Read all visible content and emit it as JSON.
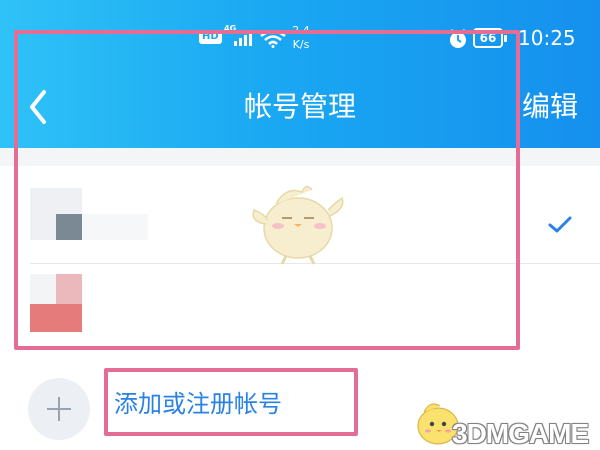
{
  "status_bar": {
    "hd": "HD",
    "network": "4G",
    "speed_value": "2.4",
    "speed_unit": "K/s",
    "battery": "66",
    "time": "10:25"
  },
  "header": {
    "title": "帐号管理",
    "edit_label": "编辑",
    "back_icon": "chevron-left-icon"
  },
  "accounts": [
    {
      "selected": true
    },
    {
      "selected": false
    }
  ],
  "add_account": {
    "label": "添加或注册帐号",
    "icon": "plus-icon"
  },
  "watermark": {
    "text": "3DMGAME"
  },
  "colors": {
    "header_start": "#2fc2f7",
    "header_end": "#1590ee",
    "highlight_border": "#e46d96",
    "link_blue": "#2a82e4",
    "check_blue": "#2a82e4"
  }
}
